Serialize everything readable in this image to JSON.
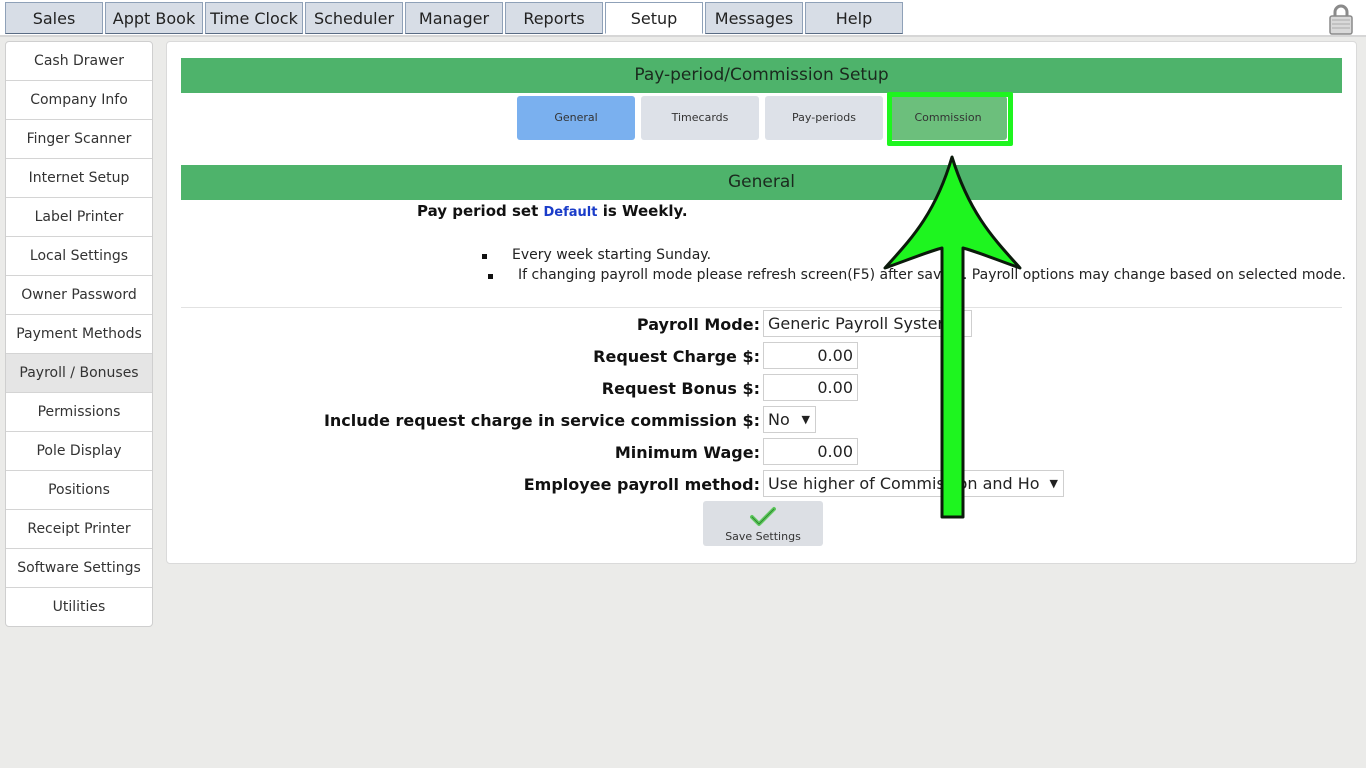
{
  "top_tabs": [
    "Sales",
    "Appt Book",
    "Time Clock",
    "Scheduler",
    "Manager",
    "Reports",
    "Setup",
    "Messages",
    "Help"
  ],
  "active_top_tab": "Setup",
  "sidebar": {
    "items": [
      "Cash Drawer",
      "Company Info",
      "Finger Scanner",
      "Internet Setup",
      "Label Printer",
      "Local Settings",
      "Owner Password",
      "Payment Methods",
      "Payroll / Bonuses",
      "Permissions",
      "Pole Display",
      "Positions",
      "Receipt Printer",
      "Software Settings",
      "Utilities"
    ],
    "active": "Payroll / Bonuses"
  },
  "panel": {
    "title": "Pay-period/Commission Setup",
    "subtabs": [
      "General",
      "Timecards",
      "Pay-periods",
      "Commission"
    ],
    "active_subtab": "General",
    "highlighted_subtab": "Commission",
    "section_title": "General",
    "pay_period": {
      "prefix": "Pay period set",
      "link": "Default",
      "suffix": "is Weekly."
    },
    "bullets": [
      "Every week starting Sunday.",
      "If changing payroll mode please refresh screen(F5) after saving. Payroll options may change based on selected mode."
    ],
    "form": {
      "payroll_mode_label": "Payroll Mode:",
      "payroll_mode_value": "Generic Payroll System",
      "request_charge_label": "Request Charge $:",
      "request_charge_value": "0.00",
      "request_bonus_label": "Request Bonus $:",
      "request_bonus_value": "0.00",
      "include_charge_label": "Include request charge in service commission $:",
      "include_charge_value": "No",
      "minimum_wage_label": "Minimum Wage:",
      "minimum_wage_value": "0.00",
      "payroll_method_label": "Employee payroll method:",
      "payroll_method_value": "Use higher of Commission and Ho"
    },
    "save_label": "Save Settings"
  },
  "colors": {
    "header_green": "#4eb36b",
    "active_subtab": "#7ab0ef",
    "highlight": "#1ef51f",
    "link": "#1a3cc9"
  },
  "icons": [
    "lock-icon",
    "checkmark-icon",
    "annotation-arrow"
  ]
}
